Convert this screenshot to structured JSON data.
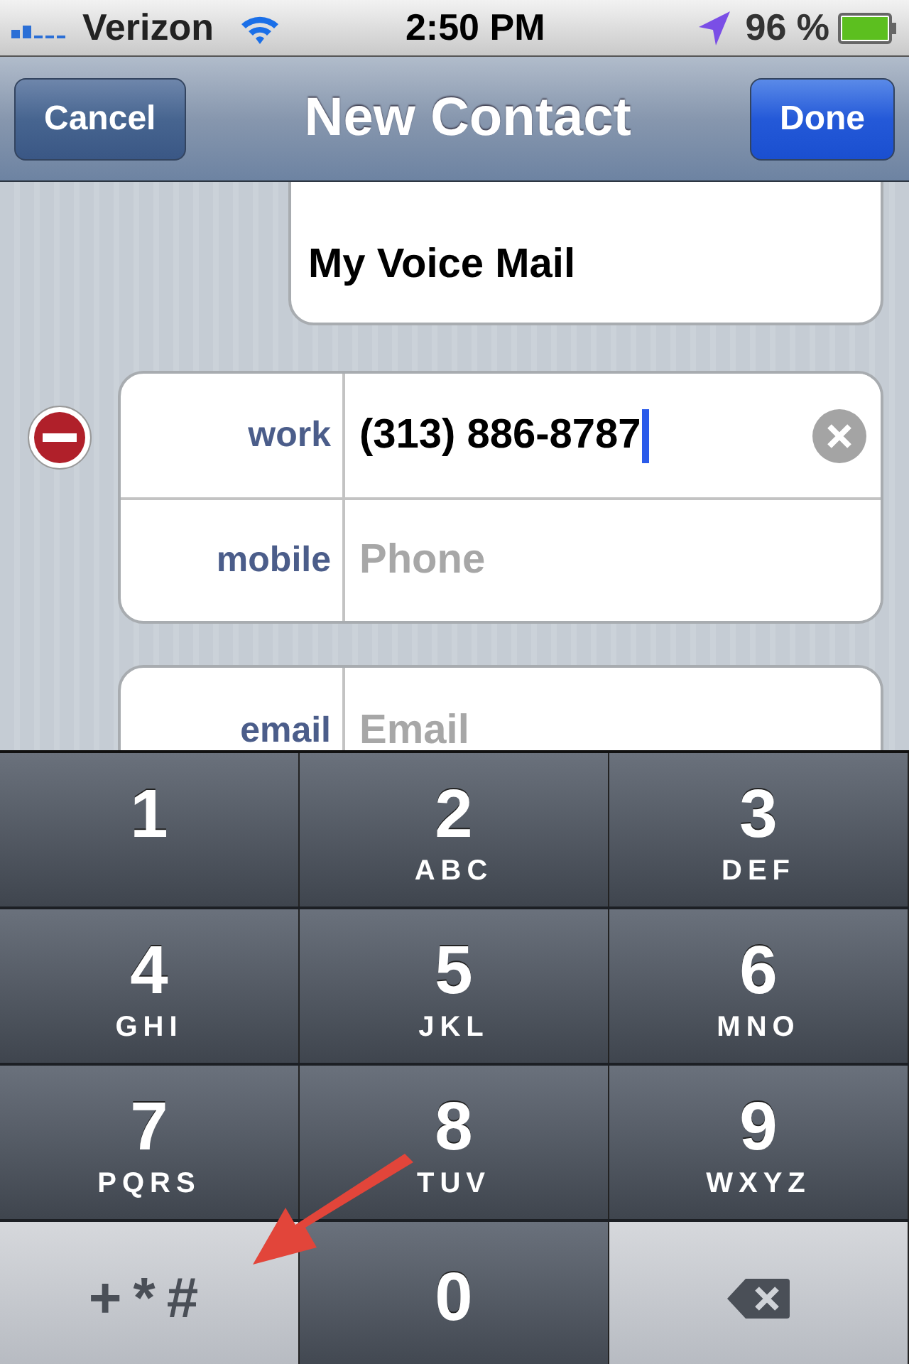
{
  "status_bar": {
    "carrier": "Verizon",
    "time": "2:50 PM",
    "battery": "96 %"
  },
  "nav": {
    "title": "New Contact",
    "left_button": "Cancel",
    "right_button": "Done"
  },
  "address_card": {
    "value": "My Voice Mail"
  },
  "phone_fields": [
    {
      "label": "work",
      "value": "(313) 886-8787",
      "focused": true
    },
    {
      "label": "mobile",
      "placeholder": "Phone",
      "focused": false
    }
  ],
  "email_fields": [
    {
      "label": "email",
      "placeholder": "Email"
    }
  ],
  "keypad": [
    {
      "kind": "digit",
      "digit": "1"
    },
    {
      "kind": "digit",
      "digit": "2",
      "letters": "ABC"
    },
    {
      "kind": "digit",
      "digit": "3",
      "letters": "DEF"
    },
    {
      "kind": "digit",
      "digit": "4",
      "letters": "GHI"
    },
    {
      "kind": "digit",
      "digit": "5",
      "letters": "JKL"
    },
    {
      "kind": "digit",
      "digit": "6",
      "letters": "MNO"
    },
    {
      "kind": "digit",
      "digit": "7",
      "letters": "PQRS"
    },
    {
      "kind": "digit",
      "digit": "8",
      "letters": "TUV"
    },
    {
      "kind": "digit",
      "digit": "9",
      "letters": "WXYZ"
    },
    {
      "kind": "symbols",
      "symbols": "+*#"
    },
    {
      "kind": "digit",
      "digit": "0"
    },
    {
      "kind": "delete"
    }
  ]
}
